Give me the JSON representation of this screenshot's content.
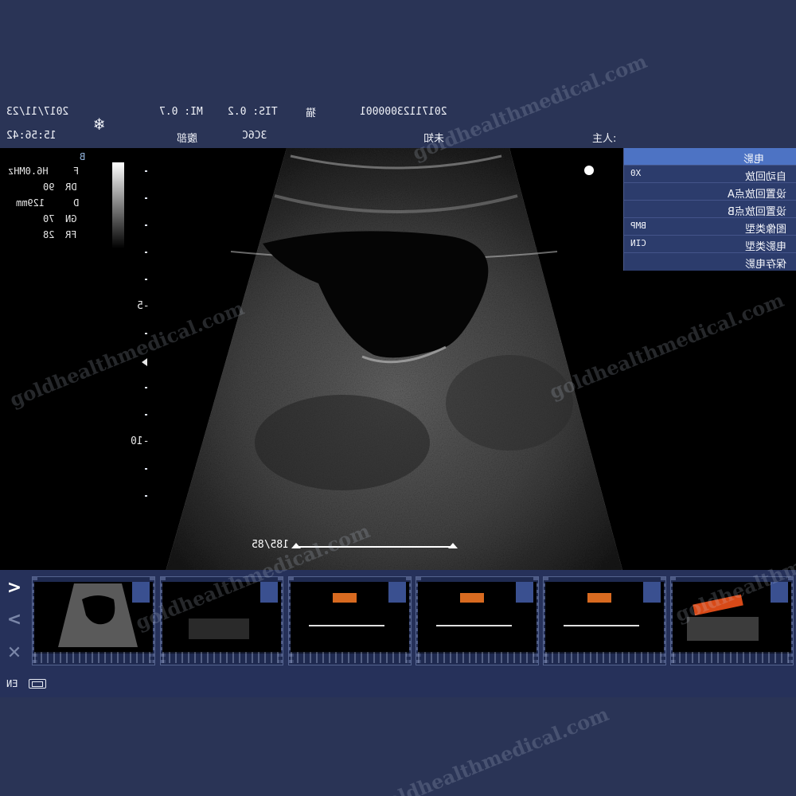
{
  "header": {
    "date": "2017/11/23",
    "time": "15:56:42",
    "freeze_icon": "snowflake-icon",
    "mi": "MI: 0.7",
    "tis": "TIS: 0.2",
    "hospital": "猫",
    "patient_id": "20171123000001",
    "exam": "腹部",
    "probe": "3C6C",
    "patient_name": "未知",
    "doctor": "主人:"
  },
  "params": {
    "mode": "B",
    "rows": [
      {
        "key": "F",
        "value": "H6.0MHz"
      },
      {
        "key": "DR",
        "value": "90"
      },
      {
        "key": "D",
        "value": "129mm"
      },
      {
        "key": "GN",
        "value": "70"
      },
      {
        "key": "FR",
        "value": "28"
      }
    ]
  },
  "depth_scale": {
    "labels": [
      "-5",
      "-10"
    ]
  },
  "cine_menu": {
    "title": "电影",
    "items": [
      {
        "label": "自动回放",
        "value": "X0"
      },
      {
        "label": "设置回放点A",
        "value": ""
      },
      {
        "label": "设置回放点B",
        "value": ""
      },
      {
        "label": "图像类型",
        "value": "BMP"
      },
      {
        "label": "电影类型",
        "value": "CIN"
      },
      {
        "label": "保存电影",
        "value": ""
      }
    ]
  },
  "cine": {
    "frame": "185/85"
  },
  "thumbnails": {
    "count": 6,
    "nav": [
      "chevron-right-icon",
      "chevron-left-icon",
      "close-icon"
    ]
  },
  "status": {
    "input_method": "EN",
    "battery_icon": "battery-icon"
  },
  "watermark": "goldhealthmedical.com",
  "colors": {
    "background": "#2a3456",
    "menu_header": "#4d73c4",
    "menu": "#2c3c6c"
  }
}
